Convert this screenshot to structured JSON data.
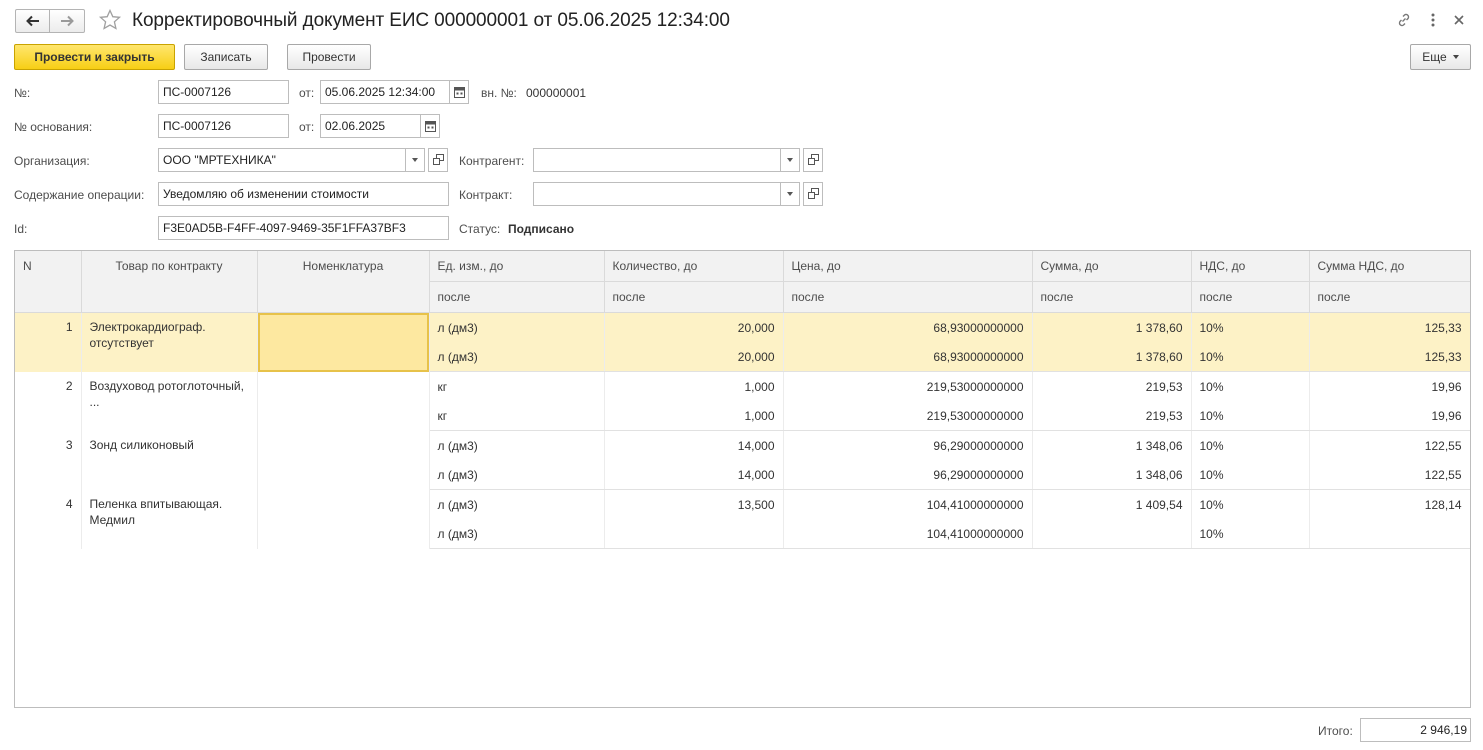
{
  "window": {
    "title": "Корректировочный документ ЕИС 000000001 от 05.06.2025 12:34:00"
  },
  "toolbar": {
    "post_close_label": "Провести и закрыть",
    "save_label": "Записать",
    "post_label": "Провести",
    "more_label": "Еще"
  },
  "form": {
    "number_label": "№:",
    "number_value": "ПС-0007126",
    "from_label": "от:",
    "date_value": "05.06.2025 12:34:00",
    "internal_label": "вн. №:",
    "internal_value": "000000001",
    "basis_number_label": "№ основания:",
    "basis_number_value": "ПС-0007126",
    "basis_from_label": "от:",
    "basis_date_value": "02.06.2025",
    "organization_label": "Организация:",
    "organization_value": "ООО \"МРТЕХНИКА\"",
    "counterparty_label": "Контрагент:",
    "counterparty_value": "",
    "operation_label": "Содержание операции:",
    "operation_value": "Уведомляю об изменении стоимости",
    "contract_label": "Контракт:",
    "contract_value": "",
    "id_label": "Id:",
    "id_value": "F3E0AD5B-F4FF-4097-9469-35F1FFA37BF3",
    "status_label": "Статус:",
    "status_value": "Подписано"
  },
  "table": {
    "headers": {
      "n": "N",
      "contract_product": "Товар по контракту",
      "nomenclature": "Номенклатура",
      "unit_before": "Ед. изм., до",
      "qty_before": "Количество, до",
      "price_before": "Цена, до",
      "sum_before": "Сумма, до",
      "vat_before": "НДС, до",
      "vat_sum_before": "Сумма НДС, до",
      "after": "после"
    },
    "rows": [
      {
        "n": "1",
        "product": "Электрокардиограф. отсутствует",
        "nomenclature": "",
        "before": {
          "unit": "л (дм3)",
          "qty": "20,000",
          "price": "68,93000000000",
          "sum": "1 378,60",
          "vat": "10%",
          "vat_sum": "125,33"
        },
        "after": {
          "unit": "л (дм3)",
          "qty": "20,000",
          "price": "68,93000000000",
          "sum": "1 378,60",
          "vat": "10%",
          "vat_sum": "125,33"
        }
      },
      {
        "n": "2",
        "product": "Воздуховод ротоглоточный, ...",
        "nomenclature": "",
        "before": {
          "unit": "кг",
          "qty": "1,000",
          "price": "219,53000000000",
          "sum": "219,53",
          "vat": "10%",
          "vat_sum": "19,96"
        },
        "after": {
          "unit": "кг",
          "qty": "1,000",
          "price": "219,53000000000",
          "sum": "219,53",
          "vat": "10%",
          "vat_sum": "19,96"
        }
      },
      {
        "n": "3",
        "product": "Зонд силиконовый",
        "nomenclature": "",
        "before": {
          "unit": "л (дм3)",
          "qty": "14,000",
          "price": "96,29000000000",
          "sum": "1 348,06",
          "vat": "10%",
          "vat_sum": "122,55"
        },
        "after": {
          "unit": "л (дм3)",
          "qty": "14,000",
          "price": "96,29000000000",
          "sum": "1 348,06",
          "vat": "10%",
          "vat_sum": "122,55"
        }
      },
      {
        "n": "4",
        "product": "Пеленка впитывающая. Медмил",
        "nomenclature": "",
        "before": {
          "unit": "л (дм3)",
          "qty": "13,500",
          "price": "104,41000000000",
          "sum": "1 409,54",
          "vat": "10%",
          "vat_sum": "128,14"
        },
        "after": {
          "unit": "л (дм3)",
          "qty": "",
          "price": "104,41000000000",
          "sum": "",
          "vat": "10%",
          "vat_sum": ""
        }
      }
    ]
  },
  "footer": {
    "total_label": "Итого:",
    "total_value": "2 946,19"
  },
  "colors": {
    "primary_button": "#f7cf15",
    "selected_row": "#fdf2c6",
    "current_cell": "#fde8a0"
  }
}
